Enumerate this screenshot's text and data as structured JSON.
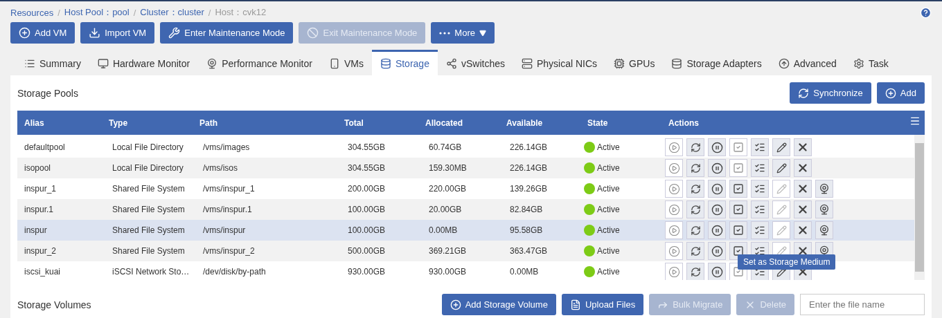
{
  "breadcrumb_separator": "/",
  "breadcrumb": [
    {
      "label": "Resources",
      "current": false
    },
    {
      "label": "Host Pool：pool",
      "current": false
    },
    {
      "label": "Cluster：cluster",
      "current": false
    },
    {
      "label": "Host：cvk12",
      "current": true
    }
  ],
  "toolbar": [
    {
      "label": "Add VM",
      "disabled": false
    },
    {
      "label": "Import VM",
      "disabled": false
    },
    {
      "label": "Enter Maintenance Mode",
      "disabled": false
    },
    {
      "label": "Exit Maintenance Mode",
      "disabled": true
    },
    {
      "label": "More",
      "disabled": false
    }
  ],
  "tabs": [
    {
      "label": "Summary",
      "selected": false
    },
    {
      "label": "Hardware Monitor",
      "selected": false
    },
    {
      "label": "Performance Monitor",
      "selected": false
    },
    {
      "label": "VMs",
      "selected": false
    },
    {
      "label": "Storage",
      "selected": true
    },
    {
      "label": "vSwitches",
      "selected": false
    },
    {
      "label": "Physical NICs",
      "selected": false
    },
    {
      "label": "GPUs",
      "selected": false
    },
    {
      "label": "Storage Adapters",
      "selected": false
    },
    {
      "label": "Advanced",
      "selected": false
    },
    {
      "label": "Task",
      "selected": false
    }
  ],
  "storage_pools": {
    "title": "Storage Pools",
    "buttons": [
      {
        "label": "Synchronize"
      },
      {
        "label": "Add"
      }
    ],
    "table": {
      "columns": [
        "Alias",
        "Type",
        "Path",
        "Total",
        "Allocated",
        "Available",
        "State",
        "Actions"
      ],
      "rows": [
        {
          "alias": "defaultpool",
          "type": "Local File Directory",
          "path": "/vms/images",
          "total": "304.55GB",
          "allocated": "60.74GB",
          "available": "226.14GB",
          "state": "Active",
          "selected": false,
          "shared": false
        },
        {
          "alias": "isopool",
          "type": "Local File Directory",
          "path": "/vms/isos",
          "total": "304.55GB",
          "allocated": "159.30MB",
          "available": "226.14GB",
          "state": "Active",
          "selected": false,
          "shared": false
        },
        {
          "alias": "inspur_1",
          "type": "Shared File System",
          "path": "/vms/inspur_1",
          "total": "200.00GB",
          "allocated": "220.00GB",
          "available": "139.26GB",
          "state": "Active",
          "selected": false,
          "shared": true
        },
        {
          "alias": "inspur.1",
          "type": "Shared File System",
          "path": "/vms/inspur.1",
          "total": "100.00GB",
          "allocated": "20.00GB",
          "available": "82.84GB",
          "state": "Active",
          "selected": false,
          "shared": true
        },
        {
          "alias": "inspur",
          "type": "Shared File System",
          "path": "/vms/inspur",
          "total": "100.00GB",
          "allocated": "0.00MB",
          "available": "95.58GB",
          "state": "Active",
          "selected": true,
          "shared": true
        },
        {
          "alias": "inspur_2",
          "type": "Shared File System",
          "path": "/vms/inspur_2",
          "total": "500.00GB",
          "allocated": "369.21GB",
          "available": "363.47GB",
          "state": "Active",
          "selected": false,
          "shared": true,
          "tooltip": "Set as Storage Medium"
        },
        {
          "alias": "iscsi_kuai",
          "type": "iSCSI Network Sto…",
          "path": "/dev/disk/by-path",
          "total": "930.00GB",
          "allocated": "930.00GB",
          "available": "0.00MB",
          "state": "Active",
          "selected": false,
          "shared": false
        }
      ]
    }
  },
  "storage_volumes": {
    "title": "Storage Volumes",
    "buttons": [
      {
        "label": "Add Storage Volume",
        "disabled": false
      },
      {
        "label": "Upload Files",
        "disabled": false
      },
      {
        "label": "Bulk Migrate",
        "disabled": true
      },
      {
        "label": "Delete",
        "disabled": true
      }
    ],
    "search": {
      "placeholder": "Enter the file name"
    }
  }
}
